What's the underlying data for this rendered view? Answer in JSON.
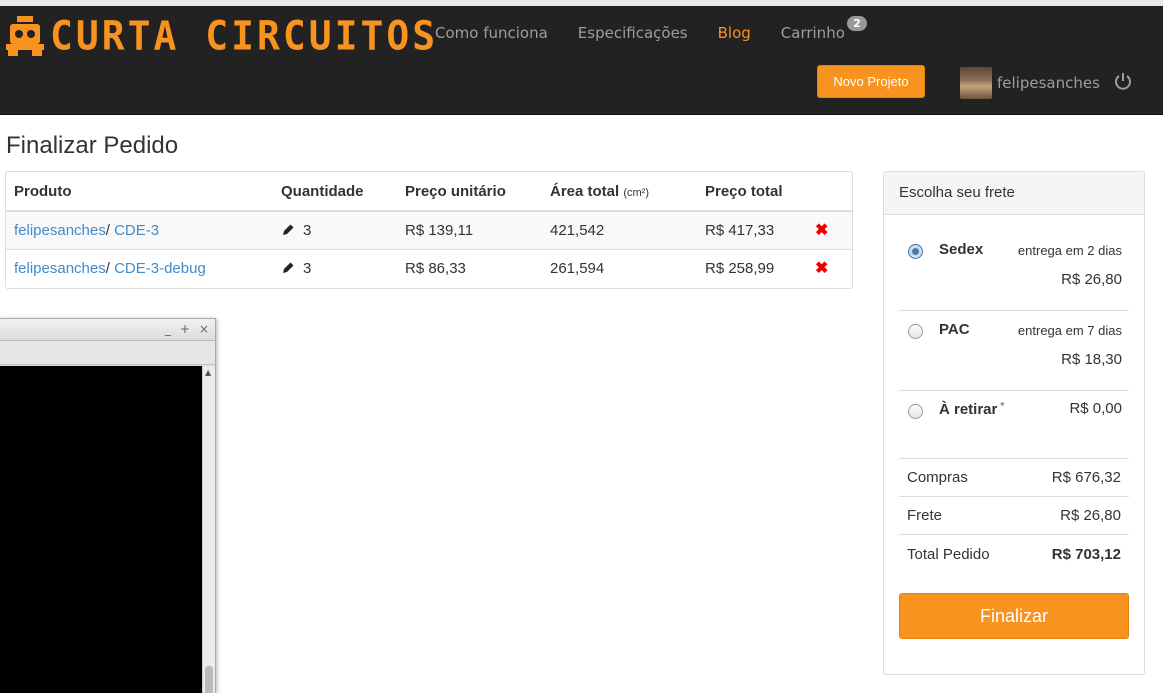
{
  "brand": {
    "name": "CURTA CIRCUITOS",
    "accent": "#f7931e",
    "navbar_bg": "#222222"
  },
  "nav": {
    "links": [
      {
        "label": "Como funciona",
        "active": false
      },
      {
        "label": "Especificações",
        "active": false
      },
      {
        "label": "Blog",
        "active": true
      },
      {
        "label": "Carrinho",
        "active": false,
        "badge": "2"
      }
    ],
    "new_project": "Novo Projeto",
    "username": "felipesanches",
    "power_icon": "power-icon"
  },
  "page": {
    "title": "Finalizar Pedido"
  },
  "order": {
    "headers": {
      "product": "Produto",
      "quantity": "Quantidade",
      "unit_price": "Preço unitário",
      "area": "Área total",
      "area_unit": "(cm²)",
      "total": "Preço total"
    },
    "rows": [
      {
        "user": "felipesanches",
        "sep": "/ ",
        "project": "CDE-3",
        "qty": "3",
        "unit_price": "R$ 139,11",
        "area": "421,542",
        "total": "R$ 417,33"
      },
      {
        "user": "felipesanches",
        "sep": "/ ",
        "project": "CDE-3-debug",
        "qty": "3",
        "unit_price": "R$ 86,33",
        "area": "261,594",
        "total": "R$ 258,99"
      }
    ]
  },
  "shipping": {
    "title": "Escolha seu frete",
    "options": [
      {
        "name": "Sedex",
        "days": "entrega em 2 dias",
        "price": "R$ 26,80",
        "selected": true
      },
      {
        "name": "PAC",
        "days": "entrega em 7 dias",
        "price": "R$ 18,30",
        "selected": false
      },
      {
        "name": "À retirar",
        "mark": "*",
        "price": "R$ 0,00",
        "selected": false
      }
    ],
    "summary": [
      {
        "label": "Compras",
        "value": "R$ 676,32"
      },
      {
        "label": "Frete",
        "value": "R$ 26,80"
      },
      {
        "label": "Total Pedido",
        "value": "R$ 703,12"
      }
    ],
    "finalize": "Finalizar"
  },
  "overlay_window": {
    "controls": [
      "_",
      "+",
      "×"
    ]
  }
}
